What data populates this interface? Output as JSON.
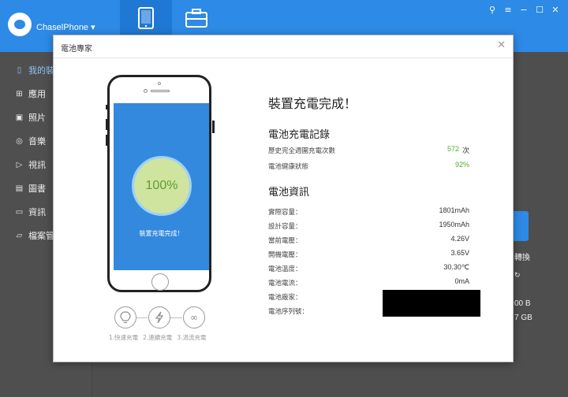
{
  "app": {
    "device_name": "ChaselPhone ▾",
    "tabs": [
      {
        "name": "device-tab",
        "icon": "tablet-icon"
      },
      {
        "name": "toolbox-tab",
        "icon": "toolbox-icon"
      }
    ],
    "window_controls": [
      "pin-icon",
      "menu-icon",
      "minimize-icon",
      "maximize-icon",
      "close-icon"
    ]
  },
  "sidebar": {
    "items": [
      {
        "label": "我的裝",
        "icon": "phone-icon",
        "active": true
      },
      {
        "label": "應用",
        "icon": "apps-icon"
      },
      {
        "label": "照片",
        "icon": "photo-icon"
      },
      {
        "label": "音樂",
        "icon": "music-icon"
      },
      {
        "label": "視訊",
        "icon": "video-icon"
      },
      {
        "label": "圖書",
        "icon": "book-icon"
      },
      {
        "label": "資訊",
        "icon": "message-icon"
      },
      {
        "label": "檔案管",
        "icon": "folder-icon"
      }
    ]
  },
  "background": {
    "convert_label": "轉換",
    "size_1": "00 B",
    "size_2": "7 GB"
  },
  "modal": {
    "title": "電池專家",
    "phone": {
      "percent": "100%",
      "message": "裝置充電完成！"
    },
    "modes": {
      "icons": [
        "bulb-icon",
        "bolt-icon",
        "infinity-icon"
      ],
      "labels": [
        "1.快速充電",
        "2.連續充電",
        "3.涓流充電"
      ]
    },
    "status_title": "裝置充電完成！",
    "charge_record": {
      "heading": "電池充電記錄",
      "cycles_label": "歷史完全週圍充電次數",
      "cycles_value": "572",
      "cycles_unit": "次",
      "health_label": "電池健康狀態",
      "health_value": "92%"
    },
    "battery_info": {
      "heading": "電池資訊",
      "rows": [
        {
          "label": "實際容量：",
          "value": "1801mAh"
        },
        {
          "label": "設計容量：",
          "value": "1950mAh"
        },
        {
          "label": "當前電壓：",
          "value": "4.26V"
        },
        {
          "label": "開機電壓：",
          "value": "3.65V"
        },
        {
          "label": "電池溫度：",
          "value": "30.30℃"
        },
        {
          "label": "電池電流：",
          "value": "0mA"
        },
        {
          "label": "電池廠家：",
          "value": ""
        },
        {
          "label": "電池序列號：",
          "value": ""
        }
      ]
    }
  },
  "colors": {
    "accent": "#2d8ae6",
    "screen": "#3389de",
    "ring_fill": "#cfe49f",
    "good": "#4caf28"
  }
}
